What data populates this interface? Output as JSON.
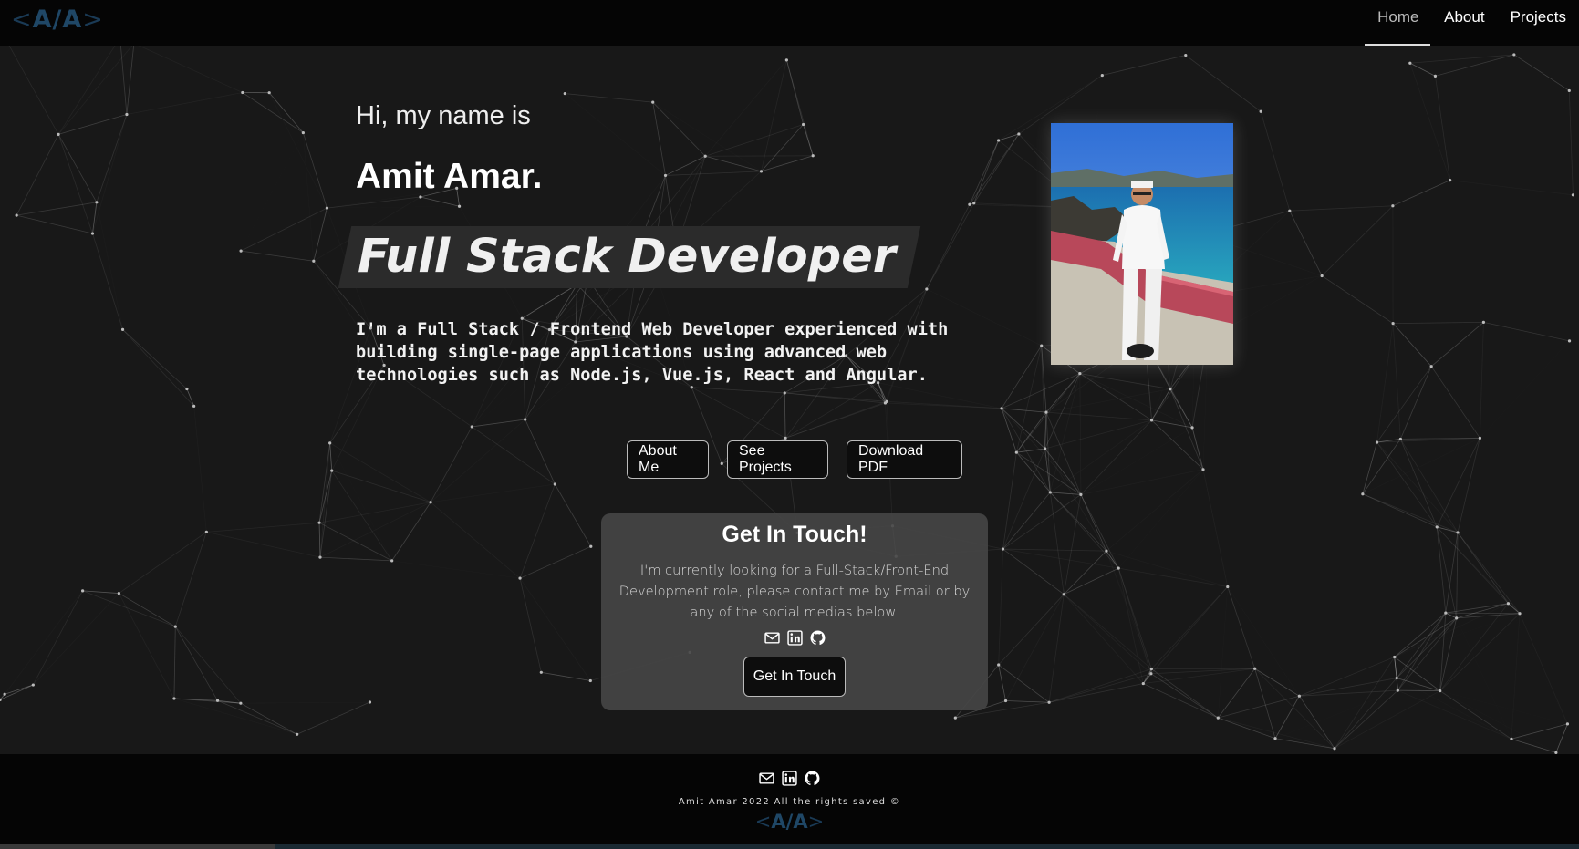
{
  "navbar": {
    "logo": {
      "open": "<",
      "text": "A/A",
      "close": ">"
    },
    "links": [
      {
        "label": "Home",
        "active": true
      },
      {
        "label": "About",
        "active": false
      },
      {
        "label": "Projects",
        "active": false
      }
    ]
  },
  "hero": {
    "greeting": "Hi, my name is",
    "name": "Amit Amar.",
    "role": "Full Stack Developer",
    "bio": "I'm a Full Stack / Frontend Web Developer experienced with building single-page applications using advanced web technologies such as Node.js, Vue.js, React and Angular.",
    "buttons": {
      "about": "About Me",
      "projects": "See Projects",
      "pdf": "Download PDF"
    }
  },
  "contact": {
    "title": "Get In Touch!",
    "text": "I'm currently looking for a Full-Stack/Front-End Development role, please contact me by Email or by any of the social medias below.",
    "button": "Get In Touch",
    "icons": [
      "envelope-icon",
      "linkedin-icon",
      "github-icon"
    ]
  },
  "footer": {
    "text": "Amit Amar 2022 All the rights saved ©",
    "logo": {
      "open": "<",
      "text": "A/A",
      "close": ">"
    }
  },
  "colors": {
    "background": "#181818",
    "navbar": "#050505",
    "logo": "#1f4766",
    "card": "#464646"
  }
}
